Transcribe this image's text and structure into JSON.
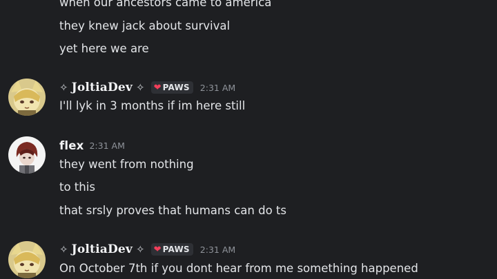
{
  "messages": [
    {
      "author": "",
      "lines": [
        "when our ancestors came to america",
        "they knew jack about survival",
        "yet here we are"
      ]
    },
    {
      "author": "JoltiaDev",
      "decorator_left": "✧",
      "decorator_right": "✧",
      "tag": {
        "icon": "heart-icon",
        "label": "PAWS"
      },
      "time": "2:31 AM",
      "lines": [
        "I'll lyk in 3 months if im here still"
      ]
    },
    {
      "author": "flex",
      "time": "2:31 AM",
      "lines": [
        "they went from nothing",
        "to this",
        "that srsly proves that humans can do ts"
      ]
    },
    {
      "author": "JoltiaDev",
      "decorator_left": "✧",
      "decorator_right": "✧",
      "tag": {
        "icon": "heart-icon",
        "label": "PAWS"
      },
      "time": "2:31 AM",
      "lines": [
        "On October 7th if you dont hear from me something happened"
      ]
    }
  ],
  "colors": {
    "background": "#1e1f22",
    "text": "#e3e5e8",
    "username": "#f2f3f5",
    "timestamp": "#8f939a",
    "tag_background": "#2e3035",
    "tag_heart": "#f23f5a"
  }
}
